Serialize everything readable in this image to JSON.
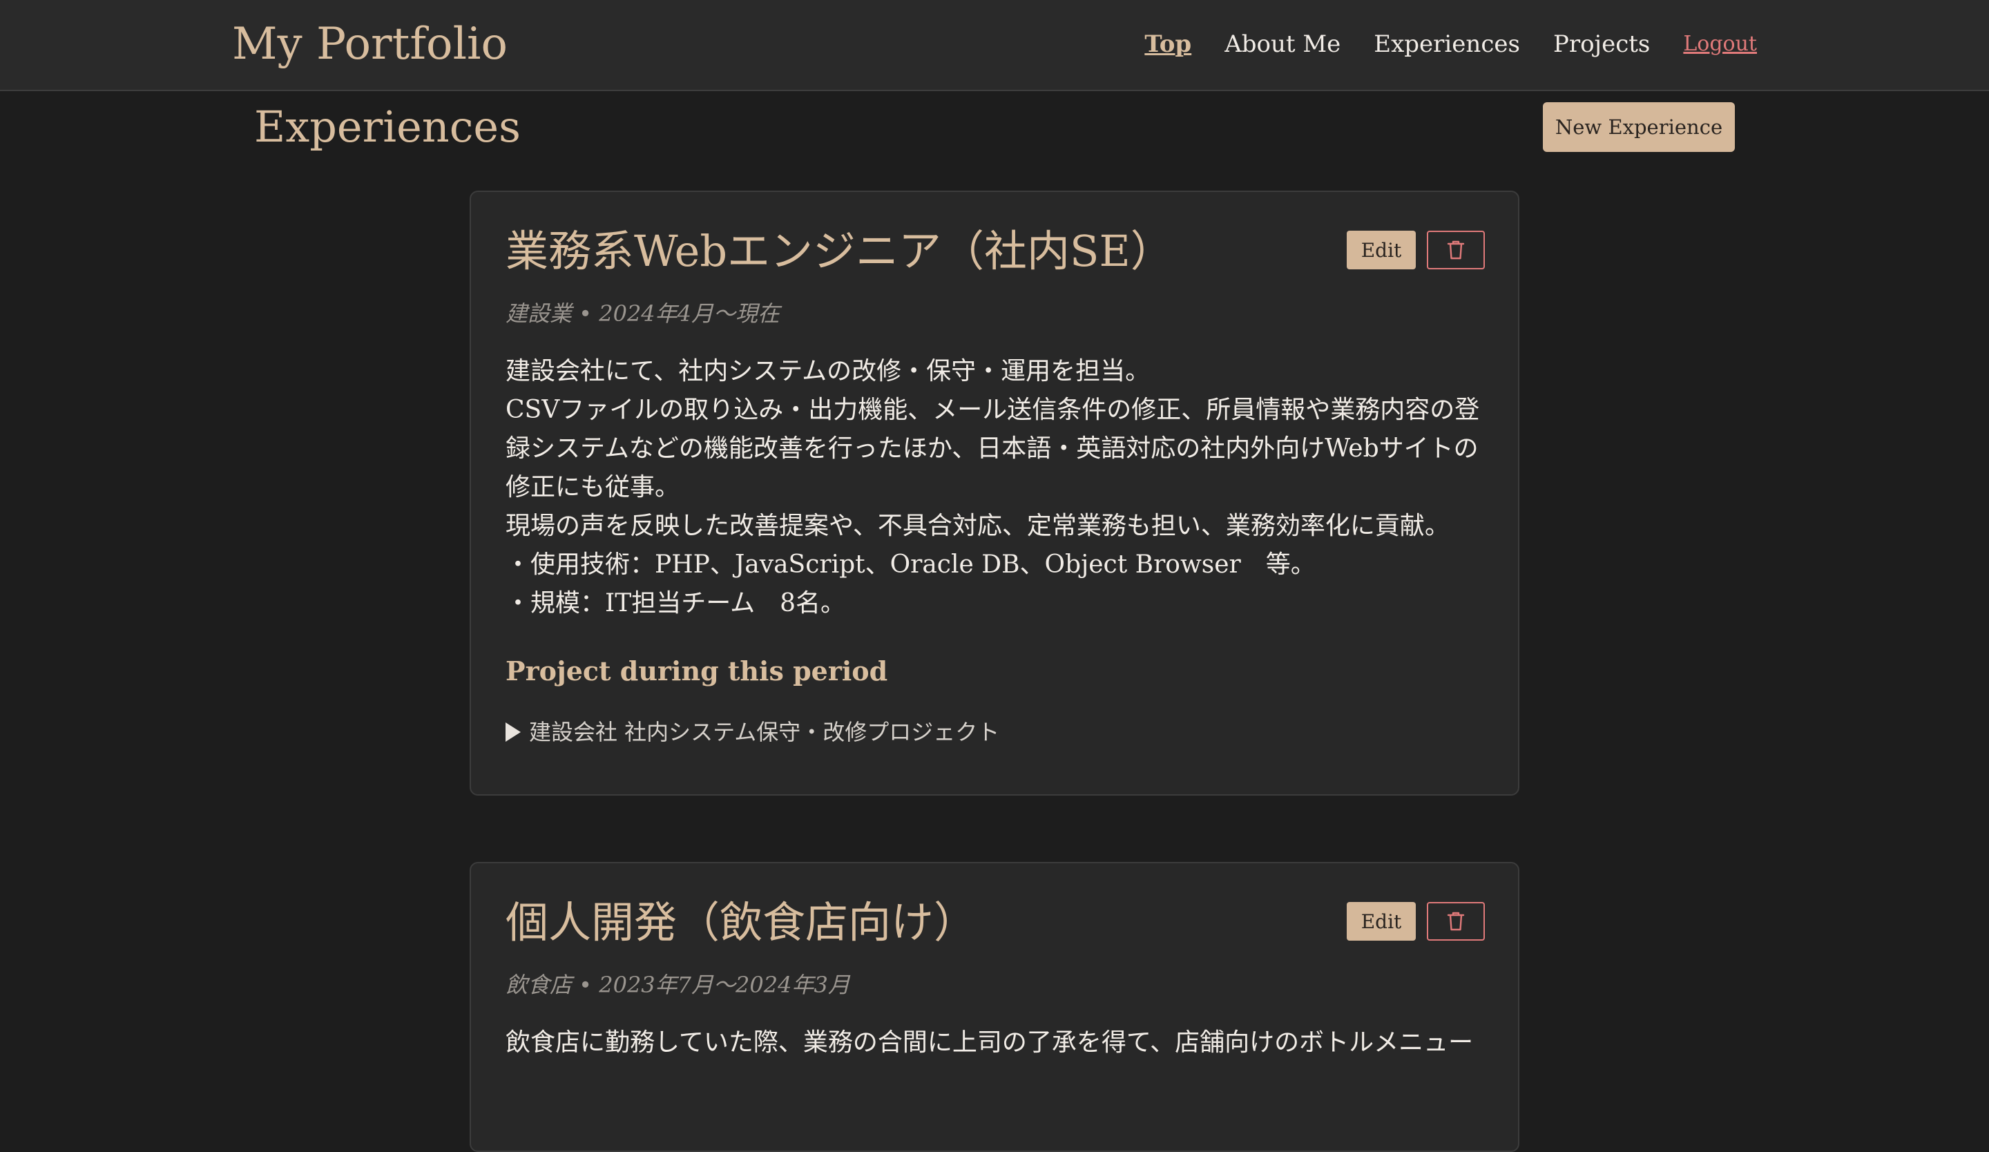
{
  "navbar": {
    "brand": "My Portfolio",
    "links": {
      "top": "Top",
      "about": "About Me",
      "experiences": "Experiences",
      "projects": "Projects",
      "logout": "Logout"
    }
  },
  "page": {
    "title": "Experiences",
    "new_button": "New Experience"
  },
  "experiences": [
    {
      "title": "業務系Webエンジニア（社内SE）",
      "meta": "建設業 • 2024年4月〜現在",
      "edit_label": "Edit",
      "delete_icon": "trash-icon",
      "description": [
        "建設会社にて、社内システムの改修・保守・運用を担当。",
        "CSVファイルの取り込み・出力機能、メール送信条件の修正、所員情報や業務内容の登",
        "録システムなどの機能改善を行ったほか、日本語・英語対応の社内外向けWebサイトの",
        "修正にも従事。",
        "現場の声を反映した改善提案や、不具合対応、定常業務も担い、業務効率化に貢献。",
        "・使用技術：PHP、JavaScript、Oracle DB、Object Browser　等。",
        "・規模：IT担当チーム　8名。"
      ],
      "project_heading": "Project during this period",
      "projects": [
        "建設会社 社内システム保守・改修プロジェクト"
      ]
    },
    {
      "title": "個人開発（飲食店向け）",
      "meta": "飲食店 • 2023年7月〜2024年3月",
      "edit_label": "Edit",
      "delete_icon": "trash-icon",
      "description": [
        "飲食店に勤務していた際、業務の合間に上司の了承を得て、店舗向けのボトルメニュー"
      ]
    }
  ],
  "colors": {
    "background": "#1d1d1d",
    "navbar": "#2a2a2a",
    "card": "#282828",
    "accent": "#d8bd9e",
    "button": "#d5b89a",
    "danger": "#e07a7a"
  }
}
